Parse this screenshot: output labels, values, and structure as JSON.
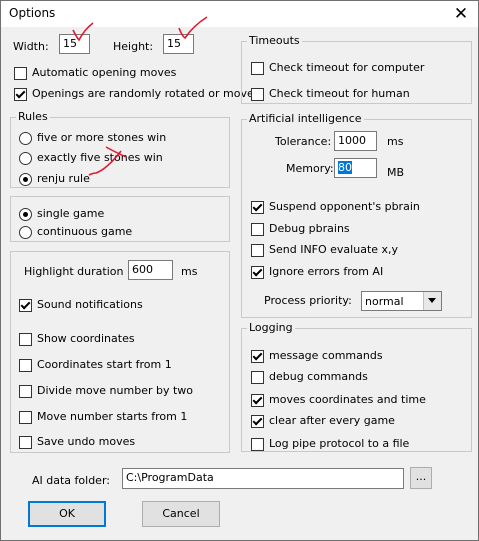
{
  "window": {
    "title": "Options",
    "close_glyph": "✕"
  },
  "size": {
    "width_label": "Width:",
    "width_value": "15",
    "height_label": "Height:",
    "height_value": "15"
  },
  "opening": {
    "automatic_label": "Automatic opening moves",
    "automatic_checked": false,
    "randomized_label": "Openings are randomly rotated or moved",
    "randomized_checked": true
  },
  "rules": {
    "title": "Rules",
    "options": [
      {
        "label": "five or more stones win",
        "selected": false
      },
      {
        "label": "exactly five stones win",
        "selected": false
      },
      {
        "label": "renju rule",
        "selected": true
      }
    ]
  },
  "mode": {
    "options": [
      {
        "label": "single game",
        "selected": true
      },
      {
        "label": "continuous game",
        "selected": false
      }
    ]
  },
  "display": {
    "highlight_label": "Highlight duration :",
    "highlight_value": "600",
    "highlight_unit": "ms",
    "checkboxes": [
      {
        "label": "Sound notifications",
        "checked": true
      },
      {
        "label": "Show coordinates",
        "checked": false
      },
      {
        "label": "Coordinates start from 1",
        "checked": false
      },
      {
        "label": "Divide move number by two",
        "checked": false
      },
      {
        "label": "Move number starts from 1",
        "checked": false
      },
      {
        "label": "Save undo moves",
        "checked": false
      }
    ]
  },
  "timeouts": {
    "title": "Timeouts",
    "checkboxes": [
      {
        "label": "Check timeout for computer",
        "checked": false
      },
      {
        "label": "Check timeout for human",
        "checked": false
      }
    ]
  },
  "ai": {
    "title": "Artificial intelligence",
    "tolerance_label": "Tolerance:",
    "tolerance_value": "1000",
    "tolerance_unit": "ms",
    "memory_label": "Memory:",
    "memory_value": "80",
    "memory_unit": "MB",
    "checkboxes": [
      {
        "label": "Suspend opponent's pbrain",
        "checked": true
      },
      {
        "label": "Debug pbrains",
        "checked": false
      },
      {
        "label": "Send INFO evaluate x,y",
        "checked": false
      },
      {
        "label": "Ignore errors from AI",
        "checked": true
      }
    ],
    "priority_label": "Process priority:",
    "priority_value": "normal"
  },
  "logging": {
    "title": "Logging",
    "checkboxes": [
      {
        "label": "message commands",
        "checked": true
      },
      {
        "label": "debug commands",
        "checked": false
      },
      {
        "label": "moves coordinates and time",
        "checked": true
      },
      {
        "label": "clear after every game",
        "checked": true
      },
      {
        "label": "Log pipe protocol to a file",
        "checked": false
      }
    ]
  },
  "folder": {
    "label": "AI data folder:",
    "value": "C:\\ProgramData",
    "browse_label": "..."
  },
  "buttons": {
    "ok": "OK",
    "cancel": "Cancel"
  },
  "colors": {
    "annotation": "#e0182d",
    "selection": "#0078d7"
  }
}
